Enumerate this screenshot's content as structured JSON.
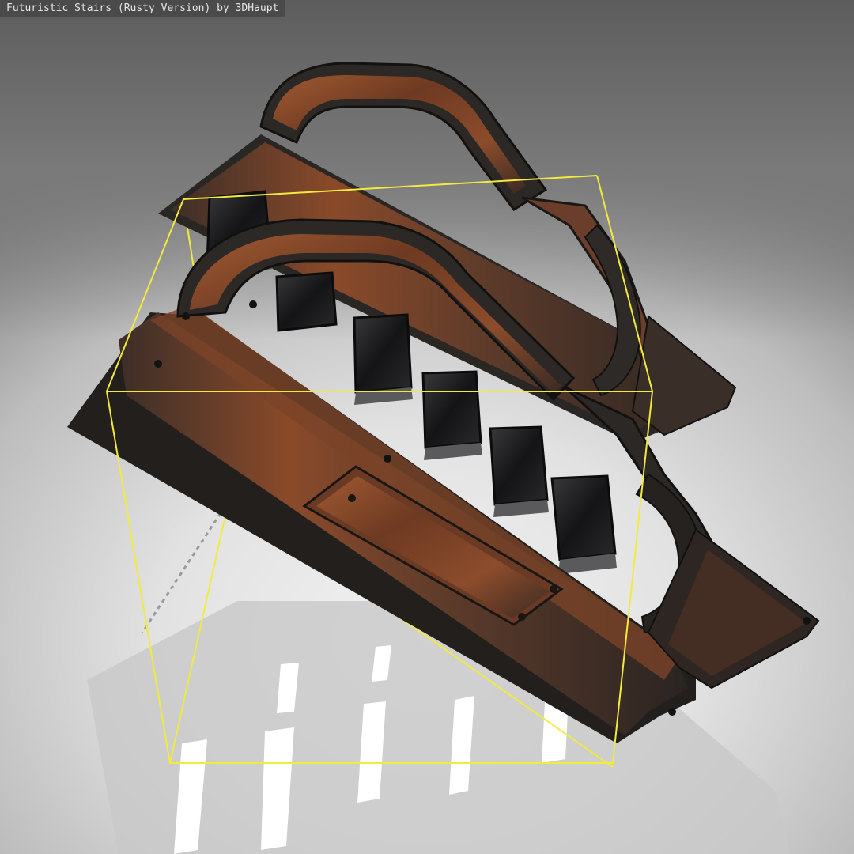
{
  "viewer": {
    "title": "Futuristic Stairs (Rusty Version) by 3DHaupt"
  },
  "colors": {
    "bounding_box": "#f2ea3c",
    "rust": "#8a4a2a",
    "dark_metal": "#2a2826",
    "step_panel": "#1e1e20",
    "shadow": "#c4c4c4",
    "shadow_highlight": "#ffffff"
  },
  "scene": {
    "object": "futuristic-stairs-model",
    "step_count": 6
  }
}
